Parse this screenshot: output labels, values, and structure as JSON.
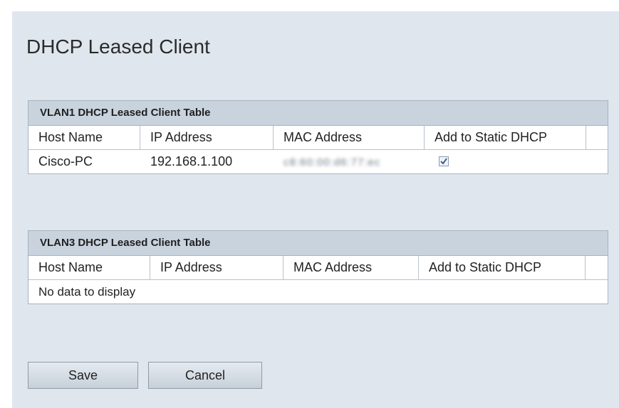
{
  "page": {
    "title": "DHCP Leased Client"
  },
  "table1": {
    "title": "VLAN1 DHCP Leased Client Table",
    "columns": [
      "Host Name",
      "IP Address",
      "MAC Address",
      "Add to Static DHCP"
    ],
    "rows": [
      {
        "host_name": "Cisco-PC",
        "ip_address": "192.168.1.100",
        "mac_address": "c8:60:00:d6:77:ec",
        "add_to_static": true
      }
    ]
  },
  "table2": {
    "title": "VLAN3 DHCP Leased Client Table",
    "columns": [
      "Host Name",
      "IP Address",
      "MAC Address",
      "Add to Static DHCP"
    ],
    "empty_message": "No data to display"
  },
  "buttons": {
    "save": "Save",
    "cancel": "Cancel"
  }
}
